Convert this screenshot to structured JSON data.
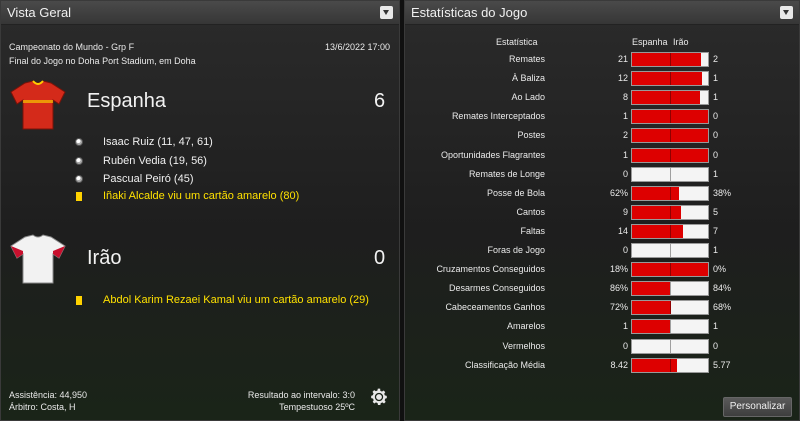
{
  "left_panel": {
    "title": "Vista Geral",
    "competition": "Campeonato do Mundo - Grp F",
    "datetime": "13/6/2022 17:00",
    "venue": "Final do Jogo no Doha Port Stadium, em Doha",
    "home": {
      "name": "Espanha",
      "score": "6",
      "shirt_color": "#d42a1a",
      "events": [
        {
          "type": "goal",
          "icon": "ball-icon",
          "text": "Isaac Ruiz (11, 47, 61)"
        },
        {
          "type": "goal",
          "icon": "ball-icon",
          "text": "Rubén Vedia (19, 56)"
        },
        {
          "type": "goal",
          "icon": "ball-icon",
          "text": "Pascual Peiró (45)"
        },
        {
          "type": "card",
          "icon": "yellow-card-icon",
          "text": "Iñaki Alcalde viu um cartão amarelo (80)"
        }
      ]
    },
    "away": {
      "name": "Irão",
      "score": "0",
      "shirt_color": "#f2f2f2",
      "events": [
        {
          "type": "card",
          "icon": "yellow-card-icon",
          "text": "Abdol Karim Rezaei Kamal viu um cartão amarelo (29)"
        }
      ]
    },
    "attendance": "Assistência: 44,950",
    "referee": "Árbitro: Costa, H",
    "halftime": "Resultado ao intervalo: 3:0",
    "weather": "Tempestuoso 25ºC"
  },
  "right_panel": {
    "title": "Estatísticas do Jogo",
    "col_stat": "Estatística",
    "col_home": "Espanha",
    "col_away": "Irão",
    "customize_label": "Personalizar",
    "bar_colors": {
      "home": "#dd0000",
      "away": "#f4f4f4"
    },
    "stats": [
      {
        "label": "Remates",
        "home": "21",
        "away": "2",
        "home_share": 0.913
      },
      {
        "label": "À Baliza",
        "home": "12",
        "away": "1",
        "home_share": 0.923
      },
      {
        "label": "Ao Lado",
        "home": "8",
        "away": "1",
        "home_share": 0.889
      },
      {
        "label": "Remates Interceptados",
        "home": "1",
        "away": "0",
        "home_share": 1.0
      },
      {
        "label": "Postes",
        "home": "2",
        "away": "0",
        "home_share": 1.0
      },
      {
        "label": "Oportunidades Flagrantes",
        "home": "1",
        "away": "0",
        "home_share": 1.0
      },
      {
        "label": "Remates de Longe",
        "home": "0",
        "away": "1",
        "home_share": 0.0
      },
      {
        "label": "Posse de Bola",
        "home": "62%",
        "away": "38%",
        "home_share": 0.62
      },
      {
        "label": "Cantos",
        "home": "9",
        "away": "5",
        "home_share": 0.643
      },
      {
        "label": "Faltas",
        "home": "14",
        "away": "7",
        "home_share": 0.667
      },
      {
        "label": "Foras de Jogo",
        "home": "0",
        "away": "1",
        "home_share": 0.0
      },
      {
        "label": "Cruzamentos Conseguidos",
        "home": "18%",
        "away": "0%",
        "home_share": 1.0
      },
      {
        "label": "Desarmes Conseguidos",
        "home": "86%",
        "away": "84%",
        "home_share": 0.506
      },
      {
        "label": "Cabeceamentos Ganhos",
        "home": "72%",
        "away": "68%",
        "home_share": 0.514
      },
      {
        "label": "Amarelos",
        "home": "1",
        "away": "1",
        "home_share": 0.5
      },
      {
        "label": "Vermelhos",
        "home": "0",
        "away": "0",
        "home_share": 0.0
      },
      {
        "label": "Classificação Média",
        "home": "8.42",
        "away": "5.77",
        "home_share": 0.593
      }
    ]
  }
}
